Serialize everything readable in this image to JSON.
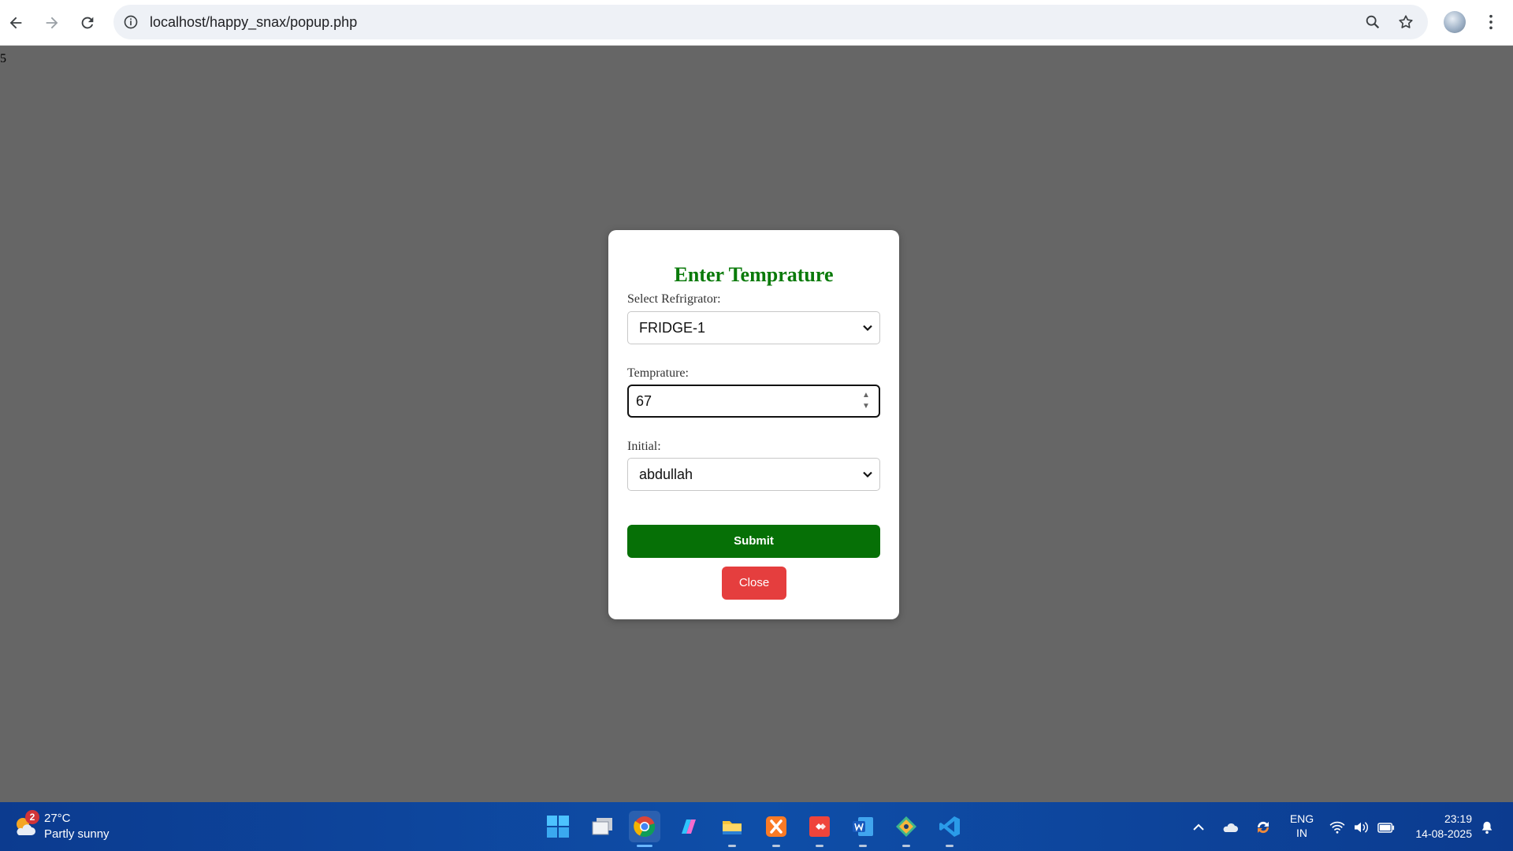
{
  "browser": {
    "url": "localhost/happy_snax/popup.php"
  },
  "page": {
    "stray_text": "5"
  },
  "popup": {
    "title": "Enter Temprature",
    "refrigerator_label": "Select Refrigrator:",
    "refrigerator_value": "FRIDGE-1",
    "temperature_label": "Temprature:",
    "temperature_value": "67",
    "initial_label": "Initial:",
    "initial_value": "abdullah",
    "submit_label": "Submit",
    "close_label": "Close"
  },
  "taskbar": {
    "weather_badge": "2",
    "weather_temp": "27°C",
    "weather_desc": "Partly sunny",
    "apps": [
      "start-icon",
      "task-view-icon",
      "chrome-icon",
      "copilot-icon",
      "file-explorer-icon",
      "xampp-icon",
      "anydesk-icon",
      "word-icon",
      "git-icon",
      "vscode-icon"
    ],
    "lang_top": "ENG",
    "lang_bottom": "IN",
    "time": "23:19",
    "date": "14-08-2025"
  },
  "colors": {
    "overlay": "#666666",
    "title_green": "#0a7a0a",
    "submit_green": "#067006",
    "close_red": "#e53e3e",
    "taskbar_blue": "#0c3b8f"
  }
}
